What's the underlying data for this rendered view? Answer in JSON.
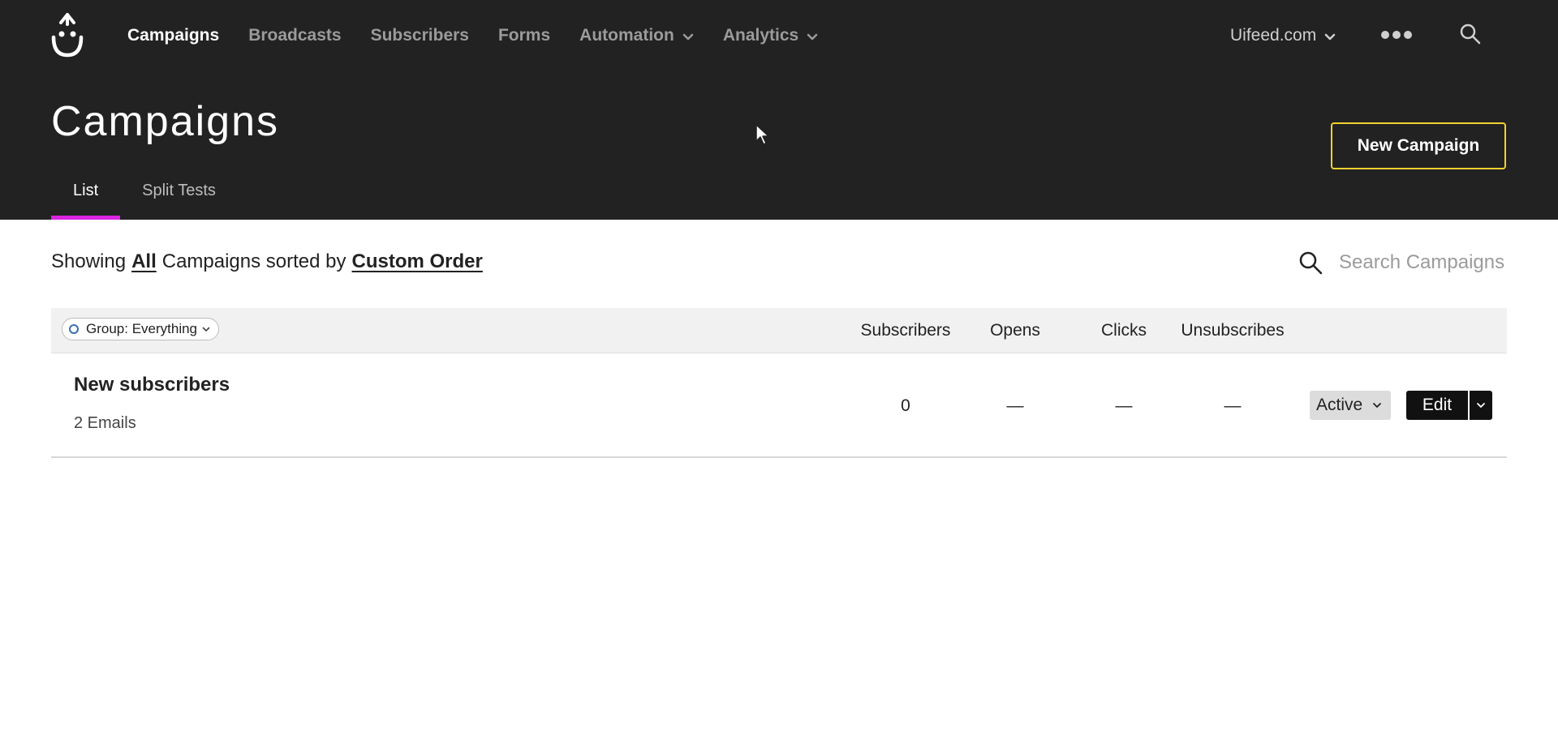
{
  "nav": {
    "items": [
      {
        "label": "Campaigns",
        "active": true,
        "dropdown": false
      },
      {
        "label": "Broadcasts",
        "active": false,
        "dropdown": false
      },
      {
        "label": "Subscribers",
        "active": false,
        "dropdown": false
      },
      {
        "label": "Forms",
        "active": false,
        "dropdown": false
      },
      {
        "label": "Automation",
        "active": false,
        "dropdown": true
      },
      {
        "label": "Analytics",
        "active": false,
        "dropdown": true
      }
    ],
    "account": "Uifeed.com"
  },
  "page": {
    "title": "Campaigns",
    "new_campaign_label": "New Campaign",
    "tabs": [
      {
        "label": "List",
        "active": true
      },
      {
        "label": "Split Tests",
        "active": false
      }
    ]
  },
  "filter": {
    "showing": "Showing",
    "scope": "All",
    "middle": "Campaigns sorted by",
    "sort": "Custom Order"
  },
  "search": {
    "placeholder": "Search Campaigns"
  },
  "table": {
    "group_filter": "Group: Everything",
    "columns": [
      "Subscribers",
      "Opens",
      "Clicks",
      "Unsubscribes"
    ],
    "rows": [
      {
        "name": "New subscribers",
        "emails": "2 Emails",
        "subscribers": "0",
        "opens": "—",
        "clicks": "—",
        "unsubscribes": "—",
        "status": "Active",
        "edit_label": "Edit"
      }
    ]
  },
  "colors": {
    "header_bg": "#222222",
    "accent_yellow": "#f2d22f",
    "tab_underline": "#d923e0",
    "group_dot": "#3a6fb5"
  },
  "icons": {
    "logo": "smiley-logo-icon",
    "more": "more-dots-icon",
    "search": "search-icon",
    "dropdown": "chevron-down-icon"
  }
}
